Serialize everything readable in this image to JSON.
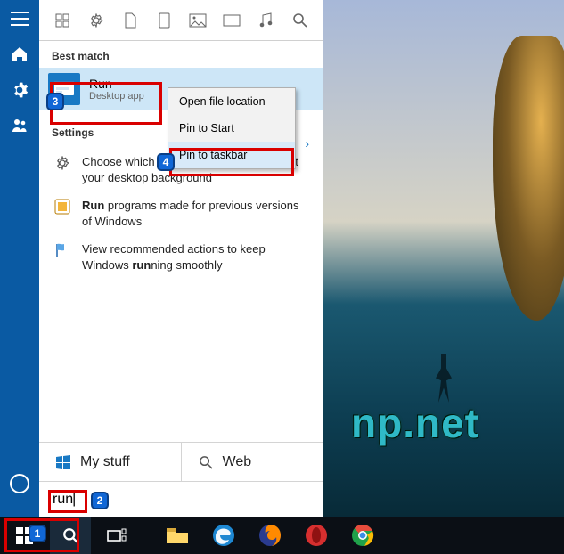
{
  "rail": {
    "items": [
      "menu",
      "home",
      "settings",
      "contacts",
      "cortana"
    ]
  },
  "filters": [
    "recent",
    "settings",
    "document",
    "tablet",
    "image",
    "monitor",
    "music",
    "search"
  ],
  "best_match_label": "Best match",
  "best_match": {
    "title": "Run",
    "subtitle": "Desktop app"
  },
  "settings_label": "Settings",
  "settings_items": [
    {
      "icon": "gear",
      "html": "Choose which hand you write with and set your desktop background",
      "text": "Choose which hand you write with and set your desktop background"
    },
    {
      "icon": "compat",
      "html": "Run programs made for previous versions of Windows",
      "text": "Run programs made for previous versions of Windows"
    },
    {
      "icon": "flag",
      "html": "View recommended actions to keep Windows running smoothly",
      "text": "View recommended actions to keep Windows running smoothly"
    }
  ],
  "context_menu": {
    "items": [
      "Open file location",
      "Pin to Start",
      "Pin to taskbar"
    ],
    "selected_index": 2
  },
  "scope": {
    "my_stuff": "My stuff",
    "web": "Web"
  },
  "search_value": "run",
  "taskbar_apps": [
    "start",
    "search",
    "taskview",
    "explorer",
    "edge",
    "firefox",
    "opera",
    "chrome"
  ],
  "watermark_text": "np.net",
  "callouts": {
    "1": "search-taskbar-button",
    "2": "search-input",
    "3": "run-best-match",
    "4": "pin-to-taskbar-menu-item"
  }
}
